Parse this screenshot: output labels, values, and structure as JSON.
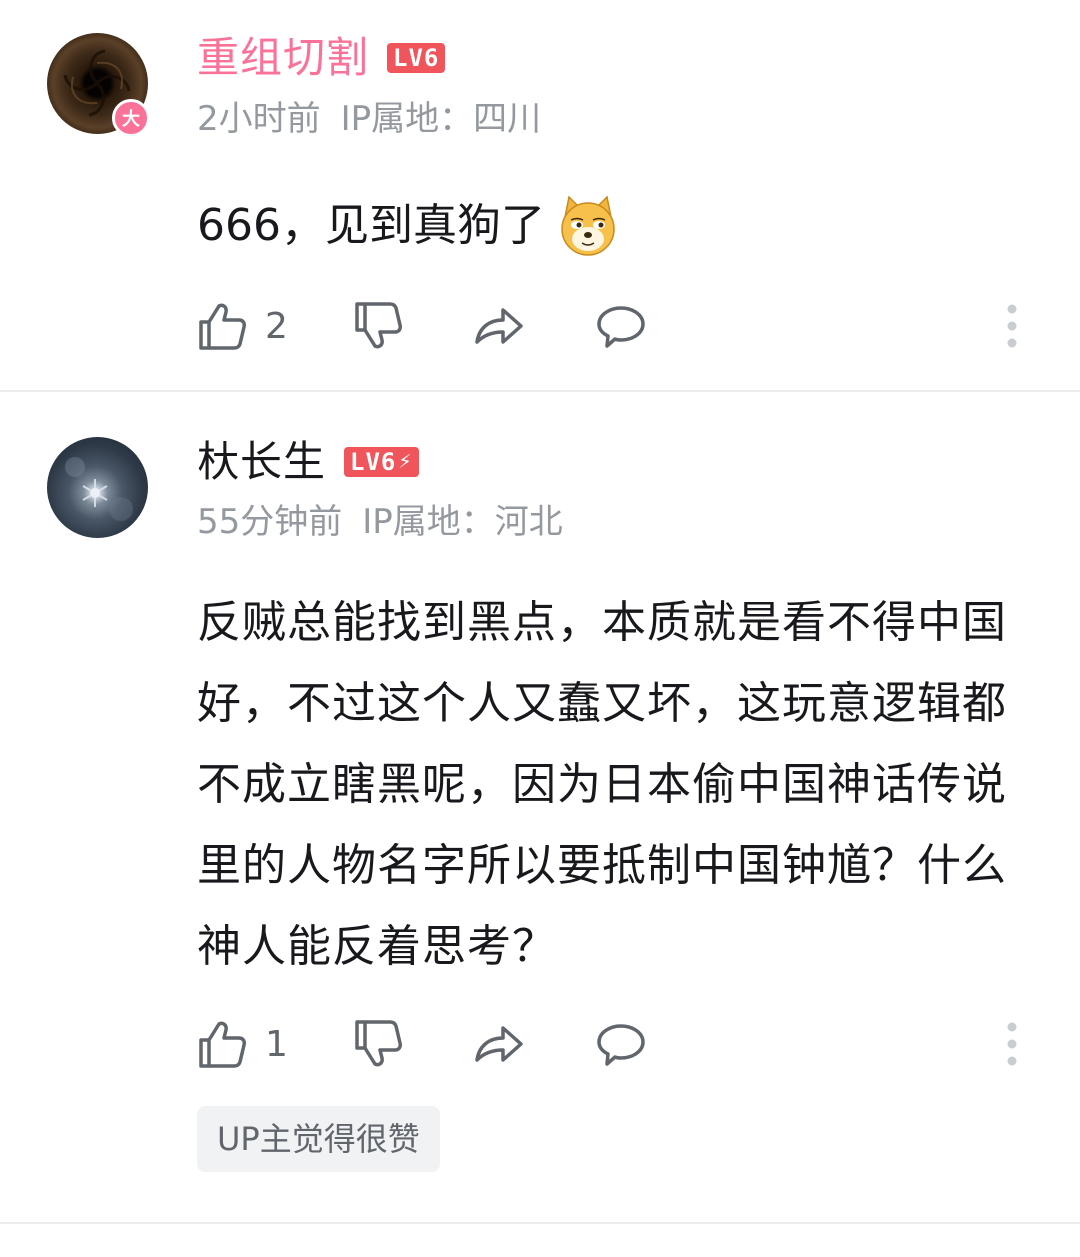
{
  "comments": [
    {
      "username": "重组切割",
      "level": "LV6",
      "vip_badge": "大",
      "time": "2小时前",
      "ip_location": "IP属地：四川",
      "content": "666，见到真狗了",
      "emoji": "doge-emoji",
      "likes": "2",
      "name_color": "#fb7299"
    },
    {
      "username": "杕长生",
      "level": "LV6",
      "level_bolt": "⚡",
      "time": "55分钟前",
      "ip_location": "IP属地：河北",
      "content": "反贼总能找到黑点，本质就是看不得中国好，不过这个人又蠢又坏，这玩意逻辑都不成立瞎黑呢，因为日本偷中国神话传说里的人物名字所以要抵制中国钟馗？什么神人能反着思考？",
      "likes": "1",
      "up_tag": "UP主觉得很赞"
    }
  ],
  "icons": [
    "thumb-up-icon",
    "thumb-down-icon",
    "share-icon",
    "reply-icon",
    "more-vertical-icon"
  ],
  "colors": {
    "accent_pink": "#fb7299",
    "level_red": "#f0555c",
    "meta_gray": "#9499a0",
    "icon_gray": "#61666d"
  }
}
